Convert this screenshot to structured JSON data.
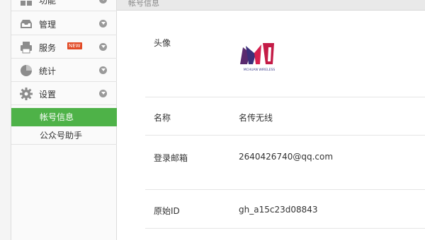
{
  "sidebar": {
    "items": [
      {
        "label": "功能",
        "icon": "grid-icon"
      },
      {
        "label": "管理",
        "icon": "inbox-icon"
      },
      {
        "label": "服务",
        "icon": "printer-icon",
        "badge": "NEW"
      },
      {
        "label": "统计",
        "icon": "pie-chart-icon"
      },
      {
        "label": "设置",
        "icon": "gear-icon"
      }
    ],
    "sub_items": [
      {
        "label": "帐号信息",
        "active": true
      },
      {
        "label": "公众号助手",
        "active": false
      }
    ],
    "accent_color": "#4eb248"
  },
  "main": {
    "header_title": "帐号信息",
    "rows": [
      {
        "label": "头像",
        "value": ""
      },
      {
        "label": "名称",
        "value": "名传无线"
      },
      {
        "label": "登录邮箱",
        "value": "2640426740@qq.com"
      },
      {
        "label": "原始ID",
        "value": "gh_a15c23d08843"
      }
    ],
    "avatar_logo_text": "MCHUAN WIRELESS"
  }
}
